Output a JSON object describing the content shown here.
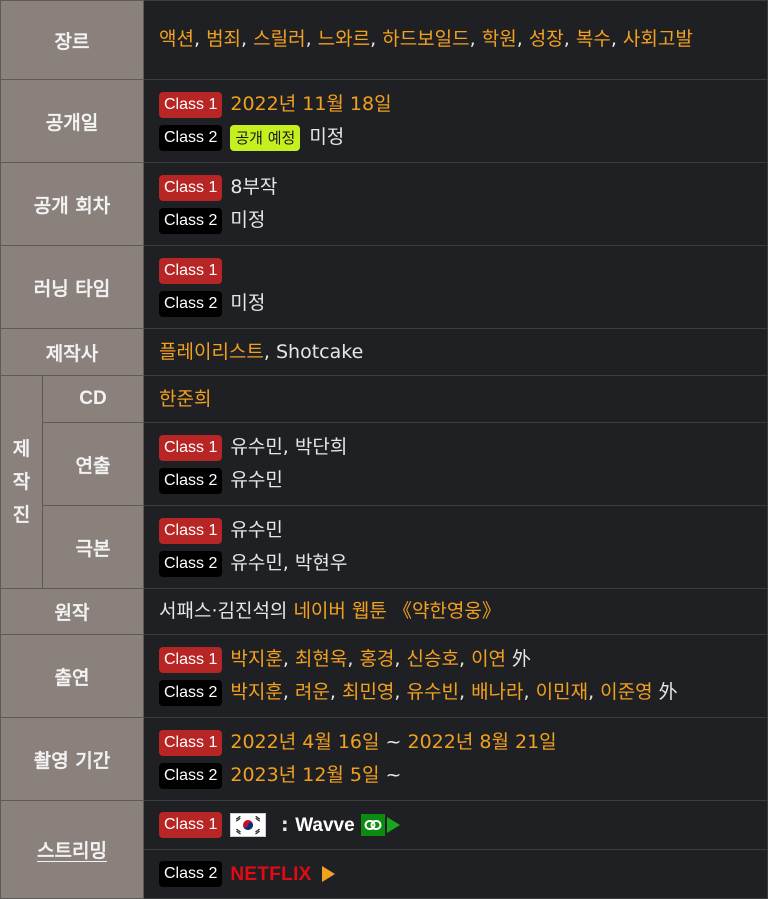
{
  "rows": {
    "genre": {
      "label": "장르",
      "items": [
        "액션",
        "범죄",
        "스릴러",
        "느와르",
        "하드보일드",
        "학원",
        "성장",
        "복수",
        "사회고발"
      ],
      "separator": ", "
    },
    "release_date": {
      "label": "공개일",
      "class1": {
        "badge": "Class 1",
        "value": "2022년 11월 18일"
      },
      "class2": {
        "badge": "Class 2",
        "pill": "공개 예정",
        "value": "미정"
      }
    },
    "episodes": {
      "label": "공개 회차",
      "class1": {
        "badge": "Class 1",
        "value": "8부작"
      },
      "class2": {
        "badge": "Class 2",
        "value": "미정"
      }
    },
    "running_time": {
      "label": "러닝 타임",
      "class1": {
        "badge": "Class 1",
        "value": ""
      },
      "class2": {
        "badge": "Class 2",
        "value": "미정"
      }
    },
    "production_company": {
      "label": "제작사",
      "primary": "플레이리스트",
      "separator": ", ",
      "secondary": "Shotcake"
    },
    "staff": {
      "label_chars": [
        "제",
        "작",
        "진"
      ],
      "cd": {
        "label": "CD",
        "value": "한준희"
      },
      "director": {
        "label": "연출",
        "class1": {
          "badge": "Class 1",
          "value": "유수민, 박단희"
        },
        "class2": {
          "badge": "Class 2",
          "value": "유수민"
        }
      },
      "writer": {
        "label": "극본",
        "class1": {
          "badge": "Class 1",
          "value": "유수민"
        },
        "class2": {
          "badge": "Class 2",
          "value": "유수민, 박현우"
        }
      }
    },
    "original": {
      "label": "원작",
      "prefix": "서패스·김진석의 ",
      "link": "네이버 웹툰",
      "title": " 《약한영웅》"
    },
    "cast": {
      "label": "출연",
      "class1": {
        "badge": "Class 1",
        "names": [
          "박지훈",
          "최현욱",
          "홍경",
          "신승호",
          "이연"
        ],
        "suffix": "外"
      },
      "class2": {
        "badge": "Class 2",
        "names": [
          "박지훈",
          "려운",
          "최민영",
          "유수빈",
          "배나라",
          "이민재",
          "이준영"
        ],
        "suffix": "外"
      }
    },
    "filming_period": {
      "label": "촬영 기간",
      "class1": {
        "badge": "Class 1",
        "start": "2022년 4월 16일",
        "tilde": " ~ ",
        "end": "2022년 8월 21일"
      },
      "class2": {
        "badge": "Class 2",
        "start": "2023년 12월 5일",
        "tilde": " ~",
        "end": ""
      }
    },
    "streaming": {
      "label": "스트리밍",
      "class1": {
        "badge": "Class 1",
        "flag": "south-korea-flag",
        "service_prefix": " : ",
        "service": "Wavve"
      },
      "class2": {
        "badge": "Class 2",
        "service": "NETFLIX"
      }
    }
  },
  "colors": {
    "header_bg": "#8a817c",
    "cell_bg": "#1f2023",
    "accent_orange": "#f2a01f",
    "class1_badge": "#b82525",
    "class2_badge": "#000000",
    "release_pill": "#c5f01f",
    "netflix_red": "#e50914",
    "wavve_green": "#0c8a12"
  }
}
